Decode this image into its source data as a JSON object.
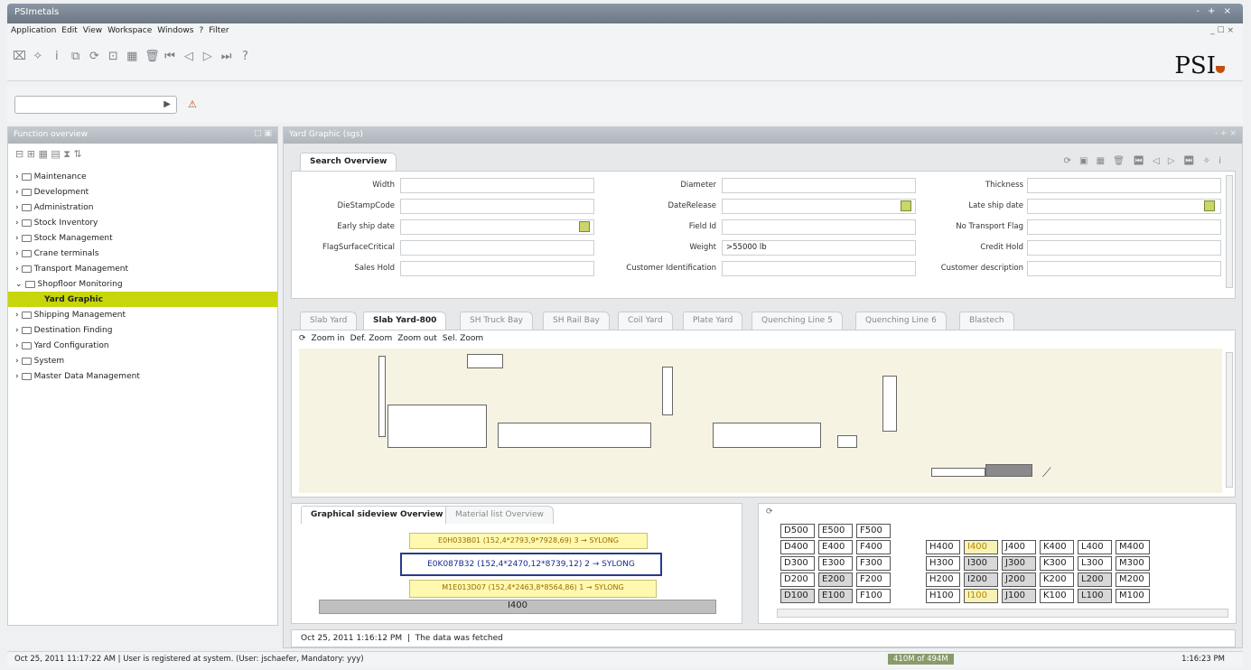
{
  "window": {
    "title": "PSImetals",
    "controls": "- + ×"
  },
  "menubar": {
    "items": [
      "Application",
      "Edit",
      "View",
      "Workspace",
      "Windows",
      "?",
      "Filter"
    ],
    "right": "_ ☐ ×"
  },
  "logo": {
    "text": "PSI"
  },
  "left_panel": {
    "title": "Function overview",
    "tree": [
      "Maintenance",
      "Development",
      "Administration",
      "Stock Inventory",
      "Stock Management",
      "Crane terminals",
      "Transport Management",
      "Shopfloor Monitoring"
    ],
    "selected": "Yard Graphic",
    "tree_after": [
      "Shipping Management",
      "Destination Finding",
      "Yard Configuration",
      "System",
      "Master Data Management"
    ]
  },
  "main_panel": {
    "title": "Yard Graphic (sgs)",
    "search_tab": "Search Overview",
    "fields": {
      "width": "Width",
      "diestampcode": "DieStampCode",
      "early_ship_date": "Early ship date",
      "flag_surface_critical": "FlagSurfaceCritical",
      "sales_hold": "Sales Hold",
      "diameter": "Diameter",
      "date_release": "DateRelease",
      "field_id": "Field Id",
      "weight": "Weight",
      "weight_value": ">55000 lb",
      "customer_identification": "Customer Identification",
      "thickness": "Thickness",
      "late_ship_date": "Late ship date",
      "no_transport_flag": "No Transport Flag",
      "credit_hold": "Credit Hold",
      "customer_description": "Customer description"
    },
    "yard_tabs": [
      "Slab Yard",
      "Slab Yard-800",
      "SH Truck Bay",
      "SH Rail Bay",
      "Coil Yard",
      "Plate Yard",
      "Quenching Line 5",
      "Quenching Line 6",
      "Blastech"
    ],
    "yard_active_tab": "Slab Yard-800",
    "zoom": {
      "zoom_in": "Zoom in",
      "def_zoom": "Def. Zoom",
      "zoom_out": "Zoom out",
      "sel_zoom": "Sel. Zoom"
    },
    "side_tabs": [
      "Graphical sideview Overview",
      "Material list Overview"
    ],
    "side_materials": [
      "E0H033B01 (152,4*2793,9*7928,69) 3 → SYLONG",
      "E0K087B32 (152,4*2470,12*8739,12) 2 → SYLONG",
      "M1E013D07 (152,4*2463,8*8564,86) 1 → SYLONG"
    ],
    "side_base": "I400",
    "grid_left": [
      [
        "D500",
        "E500",
        "F500"
      ],
      [
        "D400",
        "E400",
        "F400"
      ],
      [
        "D300",
        "E300",
        "F300"
      ],
      [
        "D200",
        "E200",
        "F200"
      ],
      [
        "D100",
        "E100",
        "F100"
      ]
    ],
    "grid_right": [
      [
        "H400",
        "I400",
        "J400",
        "K400",
        "L400",
        "M400"
      ],
      [
        "H300",
        "I300",
        "J300",
        "K300",
        "L300",
        "M300"
      ],
      [
        "H200",
        "I200",
        "J200",
        "K200",
        "L200",
        "M200"
      ],
      [
        "H100",
        "I100",
        "J100",
        "K100",
        "L100",
        "M100"
      ]
    ],
    "status": {
      "time": "Oct 25, 2011 1:16:12 PM",
      "message": "The data was fetched"
    }
  },
  "statusbar": {
    "time": "Oct 25, 2011 11:17:22 AM",
    "message": "User is registered at system. (User: jschaefer, Mandatory: yyy)",
    "memory": "410M of 494M",
    "clock": "1:16:23 PM"
  }
}
